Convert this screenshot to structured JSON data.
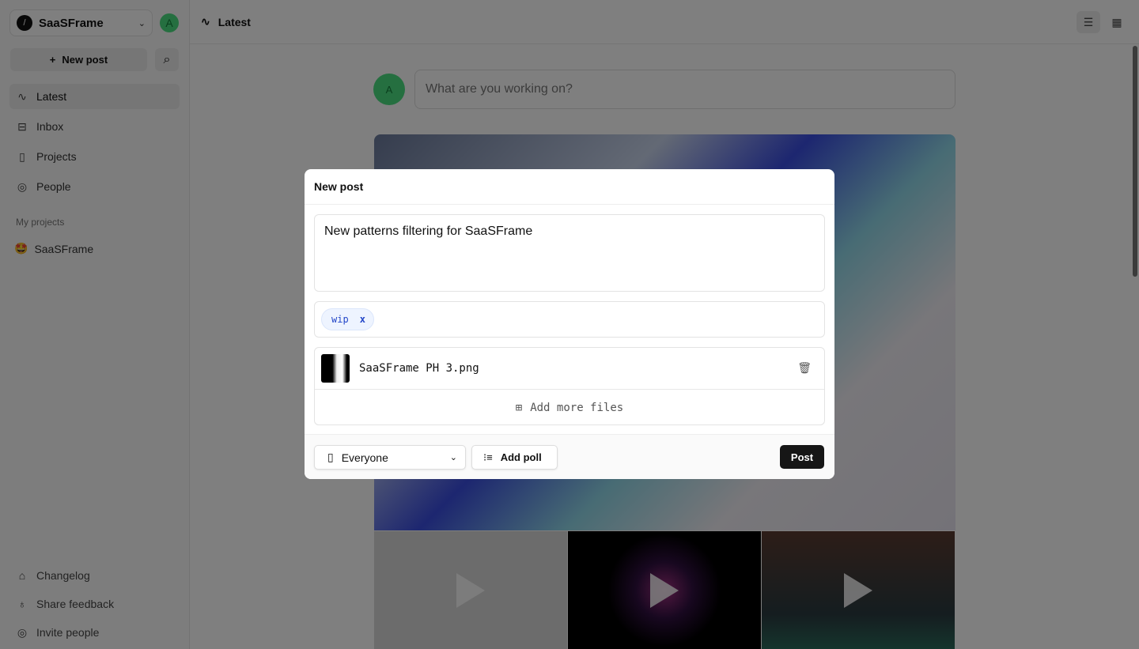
{
  "sidebar": {
    "workspace": "SaaSFrame",
    "avatar": "A",
    "new_post": "New post",
    "nav": [
      {
        "label": "Latest",
        "icon": "activity-icon"
      },
      {
        "label": "Inbox",
        "icon": "inbox-icon"
      },
      {
        "label": "Projects",
        "icon": "book-icon"
      },
      {
        "label": "People",
        "icon": "user-circle-icon"
      }
    ],
    "section": "My projects",
    "project": "SaaSFrame",
    "bottom": [
      {
        "label": "Changelog"
      },
      {
        "label": "Share feedback"
      },
      {
        "label": "Invite people"
      }
    ]
  },
  "header": {
    "title": "Latest"
  },
  "feed": {
    "avatar": "A",
    "placeholder": "What are you working on?"
  },
  "modal": {
    "title": "New post",
    "body": "New patterns filtering for SaaSFrame",
    "tag": "wip",
    "tag_remove": "x",
    "file_name": "SaaSFrame PH 3.png",
    "add_files": "Add more files",
    "audience": "Everyone",
    "add_poll": "Add poll",
    "post": "Post"
  }
}
